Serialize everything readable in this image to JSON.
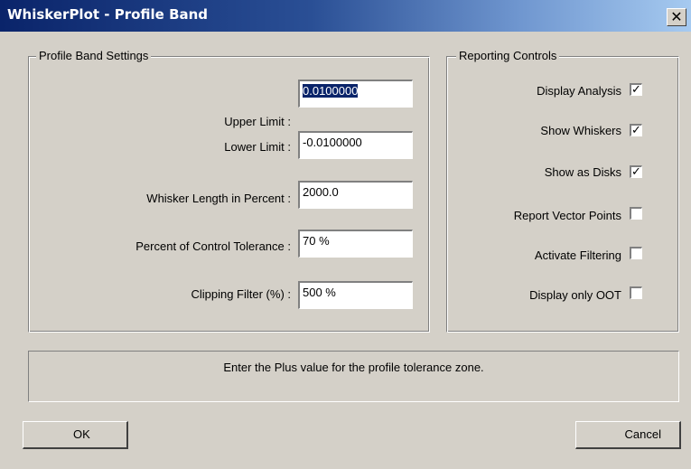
{
  "window": {
    "title": "WhiskerPlot - Profile Band",
    "close_symbol": "✕"
  },
  "profile_band": {
    "title": "Profile Band Settings",
    "fields": [
      {
        "label": "Upper Limit :",
        "value": "0.0100000",
        "selected": true
      },
      {
        "label": "Lower Limit :",
        "value": "-0.0100000"
      },
      {
        "label": "Whisker Length in Percent :",
        "value": "2000.0"
      },
      {
        "label": "Percent of Control Tolerance :",
        "value": "70 %"
      },
      {
        "label": "Clipping Filter (%) :",
        "value": "500 %"
      }
    ]
  },
  "reporting": {
    "title": "Reporting Controls",
    "options": [
      {
        "label": "Display Analysis",
        "checked": true
      },
      {
        "label": "Show Whiskers",
        "checked": true
      },
      {
        "label": "Show as Disks",
        "checked": true
      },
      {
        "label": "Report Vector Points",
        "checked": false
      },
      {
        "label": "Activate Filtering",
        "checked": false
      },
      {
        "label": "Display only OOT",
        "checked": false
      }
    ]
  },
  "status_text": "Enter the Plus value for the profile tolerance zone.",
  "buttons": {
    "ok": "OK",
    "cancel": "Cancel"
  }
}
